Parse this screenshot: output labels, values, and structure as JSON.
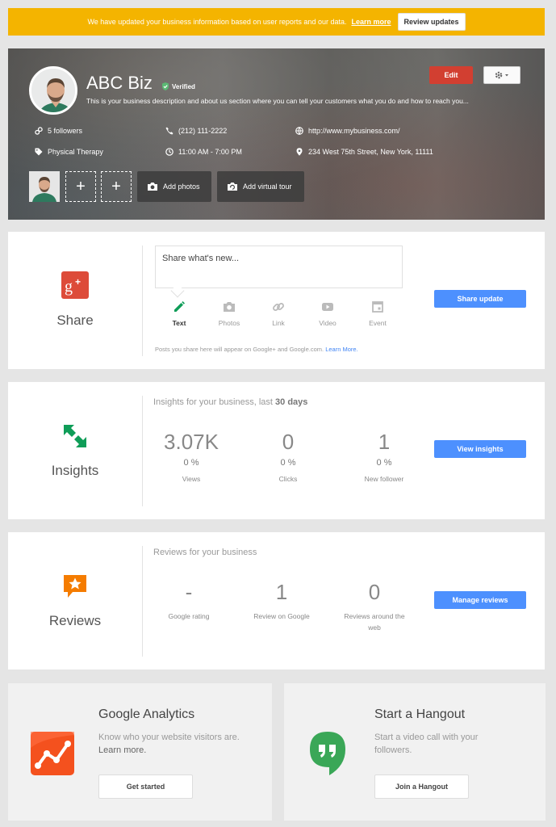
{
  "banner": {
    "message": "We have updated your business information based on user reports and our data.",
    "learn_more": "Learn more",
    "review_button": "Review updates"
  },
  "profile": {
    "name": "ABC Biz",
    "verified_label": "Verified",
    "description": "This is your business description and about us section where you can tell your customers what you do and how to reach you...",
    "edit_button": "Edit",
    "followers": "5 followers",
    "phone": "(212) 111-2222",
    "website": "http://www.mybusiness.com/",
    "category": "Physical Therapy",
    "hours": "11:00 AM - 7:00 PM",
    "address": "234 West 75th Street, New York, 11111",
    "add_slot_symbol": "+",
    "add_photos": "Add photos",
    "add_virtual_tour": "Add virtual tour"
  },
  "share": {
    "title": "Share",
    "placeholder": "Share what's new...",
    "types": [
      "Text",
      "Photos",
      "Link",
      "Video",
      "Event"
    ],
    "note": "Posts you share here will appear on Google+ and Google.com.",
    "note_link": "Learn More.",
    "button": "Share update"
  },
  "insights": {
    "title": "Insights",
    "heading": "Insights for your business, last",
    "heading_bold": "30 days",
    "stats": [
      {
        "value": "3.07K",
        "pct": "0 %",
        "label": "Views"
      },
      {
        "value": "0",
        "pct": "0 %",
        "label": "Clicks"
      },
      {
        "value": "1",
        "pct": "0 %",
        "label": "New follower"
      }
    ],
    "button": "View insights"
  },
  "reviews": {
    "title": "Reviews",
    "heading": "Reviews for your business",
    "stats": [
      {
        "value": "-",
        "label": "Google rating"
      },
      {
        "value": "1",
        "label": "Review on Google"
      },
      {
        "value": "0",
        "label": "Reviews around the web"
      }
    ],
    "button": "Manage reviews"
  },
  "analytics": {
    "title": "Google Analytics",
    "desc": "Know who your website visitors are.",
    "desc_link": "Learn more.",
    "button": "Get started"
  },
  "hangout": {
    "title": "Start a Hangout",
    "desc": "Start a video call with your followers.",
    "button": "Join a Hangout"
  },
  "colors": {
    "banner": "#f4b400",
    "edit": "#d23f31",
    "primary": "#4d90fe",
    "gplus": "#dd4b39",
    "insights": "#0f9d58",
    "reviews": "#f57c00",
    "hangout": "#0f9d58"
  }
}
